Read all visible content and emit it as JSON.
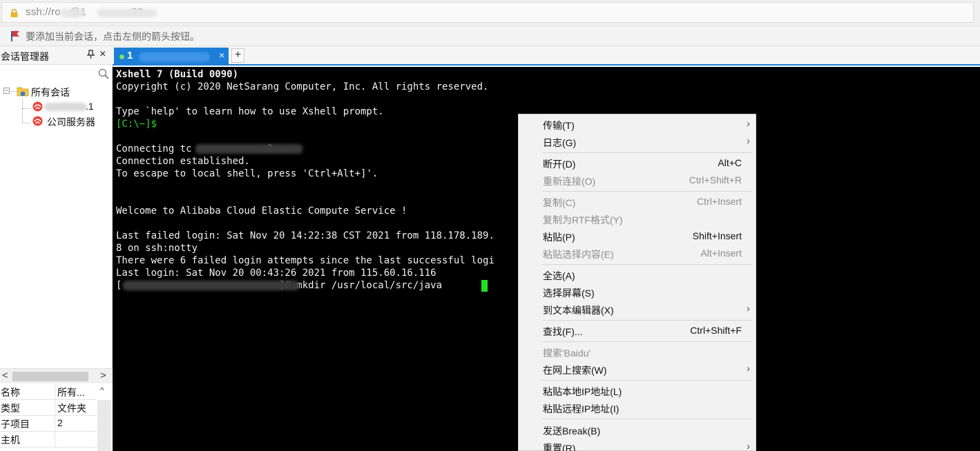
{
  "address_bar": {
    "url": "ssh://ro   @1              :22"
  },
  "hint_bar": {
    "text": "要添加当前会话，点击左侧的箭头按钮。"
  },
  "session_manager": {
    "title": "会话管理器",
    "pin": "⊥",
    "close": "×",
    "tree": {
      "root_label": "所有会话",
      "sessions": [
        {
          "label": ".1"
        },
        {
          "label": "公司服务器"
        }
      ]
    },
    "scroll": {
      "left": "<",
      "right": ">"
    },
    "properties": [
      {
        "key": "名称",
        "value": "所有..."
      },
      {
        "key": "类型",
        "value": "文件夹"
      },
      {
        "key": "子项目",
        "value": "2"
      },
      {
        "key": "主机",
        "value": ""
      }
    ],
    "props_scroll_up": "^"
  },
  "tabs": {
    "active": {
      "number": "1",
      "close": "×"
    },
    "add": "+"
  },
  "terminal": {
    "lines": [
      "Xshell 7 (Build 0090)",
      "Copyright (c) 2020 NetSarang Computer, Inc. All rights reserved.",
      "Type `help' to learn how to use Xshell prompt.",
      "[C:\\~]$",
      "Connecting tc            .2...",
      "Connection established.",
      "To escape to local shell, press 'Ctrl+Alt+]'.",
      "Welcome to Alibaba Cloud Elastic Compute Service !",
      "Last failed login: Sat Nov 20 14:22:38 CST 2021 from 118.178.189.",
      "8 on ssh:notty",
      "There were 6 failed login attempts since the last successful logi",
      "Last login: Sat Nov 20 00:43:26 2021 from 115.60.16.116",
      "[                          ~]# mkdir /usr/local/src/java"
    ]
  },
  "context_menu": {
    "items": [
      {
        "label": "传输(T)",
        "shortcut": "",
        "submenu": true,
        "disabled": false
      },
      {
        "label": "日志(G)",
        "shortcut": "",
        "submenu": true,
        "disabled": false
      },
      {
        "label": "断开(D)",
        "shortcut": "Alt+C",
        "submenu": false,
        "disabled": false
      },
      {
        "label": "重新连接(O)",
        "shortcut": "Ctrl+Shift+R",
        "submenu": false,
        "disabled": true
      },
      {
        "label": "复制(C)",
        "shortcut": "Ctrl+Insert",
        "submenu": false,
        "disabled": true
      },
      {
        "label": "复制为RTF格式(Y)",
        "shortcut": "",
        "submenu": false,
        "disabled": true
      },
      {
        "label": "粘贴(P)",
        "shortcut": "Shift+Insert",
        "submenu": false,
        "disabled": false
      },
      {
        "label": "粘贴选择内容(E)",
        "shortcut": "Alt+Insert",
        "submenu": false,
        "disabled": true
      },
      {
        "label": "全选(A)",
        "shortcut": "",
        "submenu": false,
        "disabled": false
      },
      {
        "label": "选择屏幕(S)",
        "shortcut": "",
        "submenu": false,
        "disabled": false
      },
      {
        "label": "到文本编辑器(X)",
        "shortcut": "",
        "submenu": true,
        "disabled": false
      },
      {
        "label": "查找(F)...",
        "shortcut": "Ctrl+Shift+F",
        "submenu": false,
        "disabled": false
      },
      {
        "label": "搜索'Baidu'",
        "shortcut": "",
        "submenu": false,
        "disabled": true
      },
      {
        "label": "在网上搜索(W)",
        "shortcut": "",
        "submenu": true,
        "disabled": false
      },
      {
        "label": "粘贴本地IP地址(L)",
        "shortcut": "",
        "submenu": false,
        "disabled": false
      },
      {
        "label": "粘贴远程IP地址(I)",
        "shortcut": "",
        "submenu": false,
        "disabled": false
      },
      {
        "label": "发送Break(B)",
        "shortcut": "",
        "submenu": false,
        "disabled": false
      },
      {
        "label": "重置(R)",
        "shortcut": "",
        "submenu": true,
        "disabled": false
      }
    ],
    "arrow": "›"
  },
  "colors": {
    "tab_active": "#1c7ed6",
    "terminal_bg": "#000000",
    "prompt_green": "#30d830",
    "cursor": "#22e022"
  }
}
